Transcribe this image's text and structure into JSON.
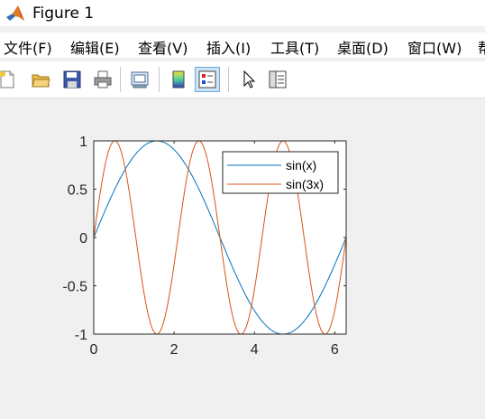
{
  "window": {
    "title": "Figure 1"
  },
  "menu": {
    "items": [
      "文件(F)",
      "编辑(E)",
      "查看(V)",
      "插入(I)",
      "工具(T)",
      "桌面(D)",
      "窗口(W)",
      "帮"
    ]
  },
  "toolbar": {
    "buttons": [
      {
        "icon": "new-figure-icon"
      },
      {
        "icon": "open-file-icon"
      },
      {
        "icon": "save-icon"
      },
      {
        "icon": "print-icon"
      },
      {
        "icon": "link-plot-icon"
      },
      {
        "icon": "insert-colorbar-icon"
      },
      {
        "icon": "insert-legend-icon",
        "active": true
      },
      {
        "icon": "edit-plot-pointer-icon"
      },
      {
        "icon": "property-inspector-icon"
      }
    ]
  },
  "colors": {
    "series1": "#0072bd",
    "series2": "#d95319",
    "axes_bg": "#ffffff",
    "figure_bg": "#f0f0f0"
  },
  "chart_data": {
    "type": "line",
    "xlim": [
      0,
      6.2832
    ],
    "ylim": [
      -1,
      1
    ],
    "xticks": [
      0,
      2,
      4,
      6
    ],
    "xtick_labels": [
      "0",
      "2",
      "4",
      "6"
    ],
    "yticks": [
      1,
      0.5,
      0,
      -0.5,
      -1
    ],
    "ytick_labels": [
      "1",
      "0.5",
      "0",
      "-0.5",
      "-1"
    ],
    "grid": false,
    "legend_position": "top-right",
    "series": [
      {
        "name": "sin(x)",
        "function": "sin(x)",
        "color": "#0072bd"
      },
      {
        "name": "sin(3x)",
        "function": "sin(3x)",
        "color": "#d95319"
      }
    ]
  }
}
